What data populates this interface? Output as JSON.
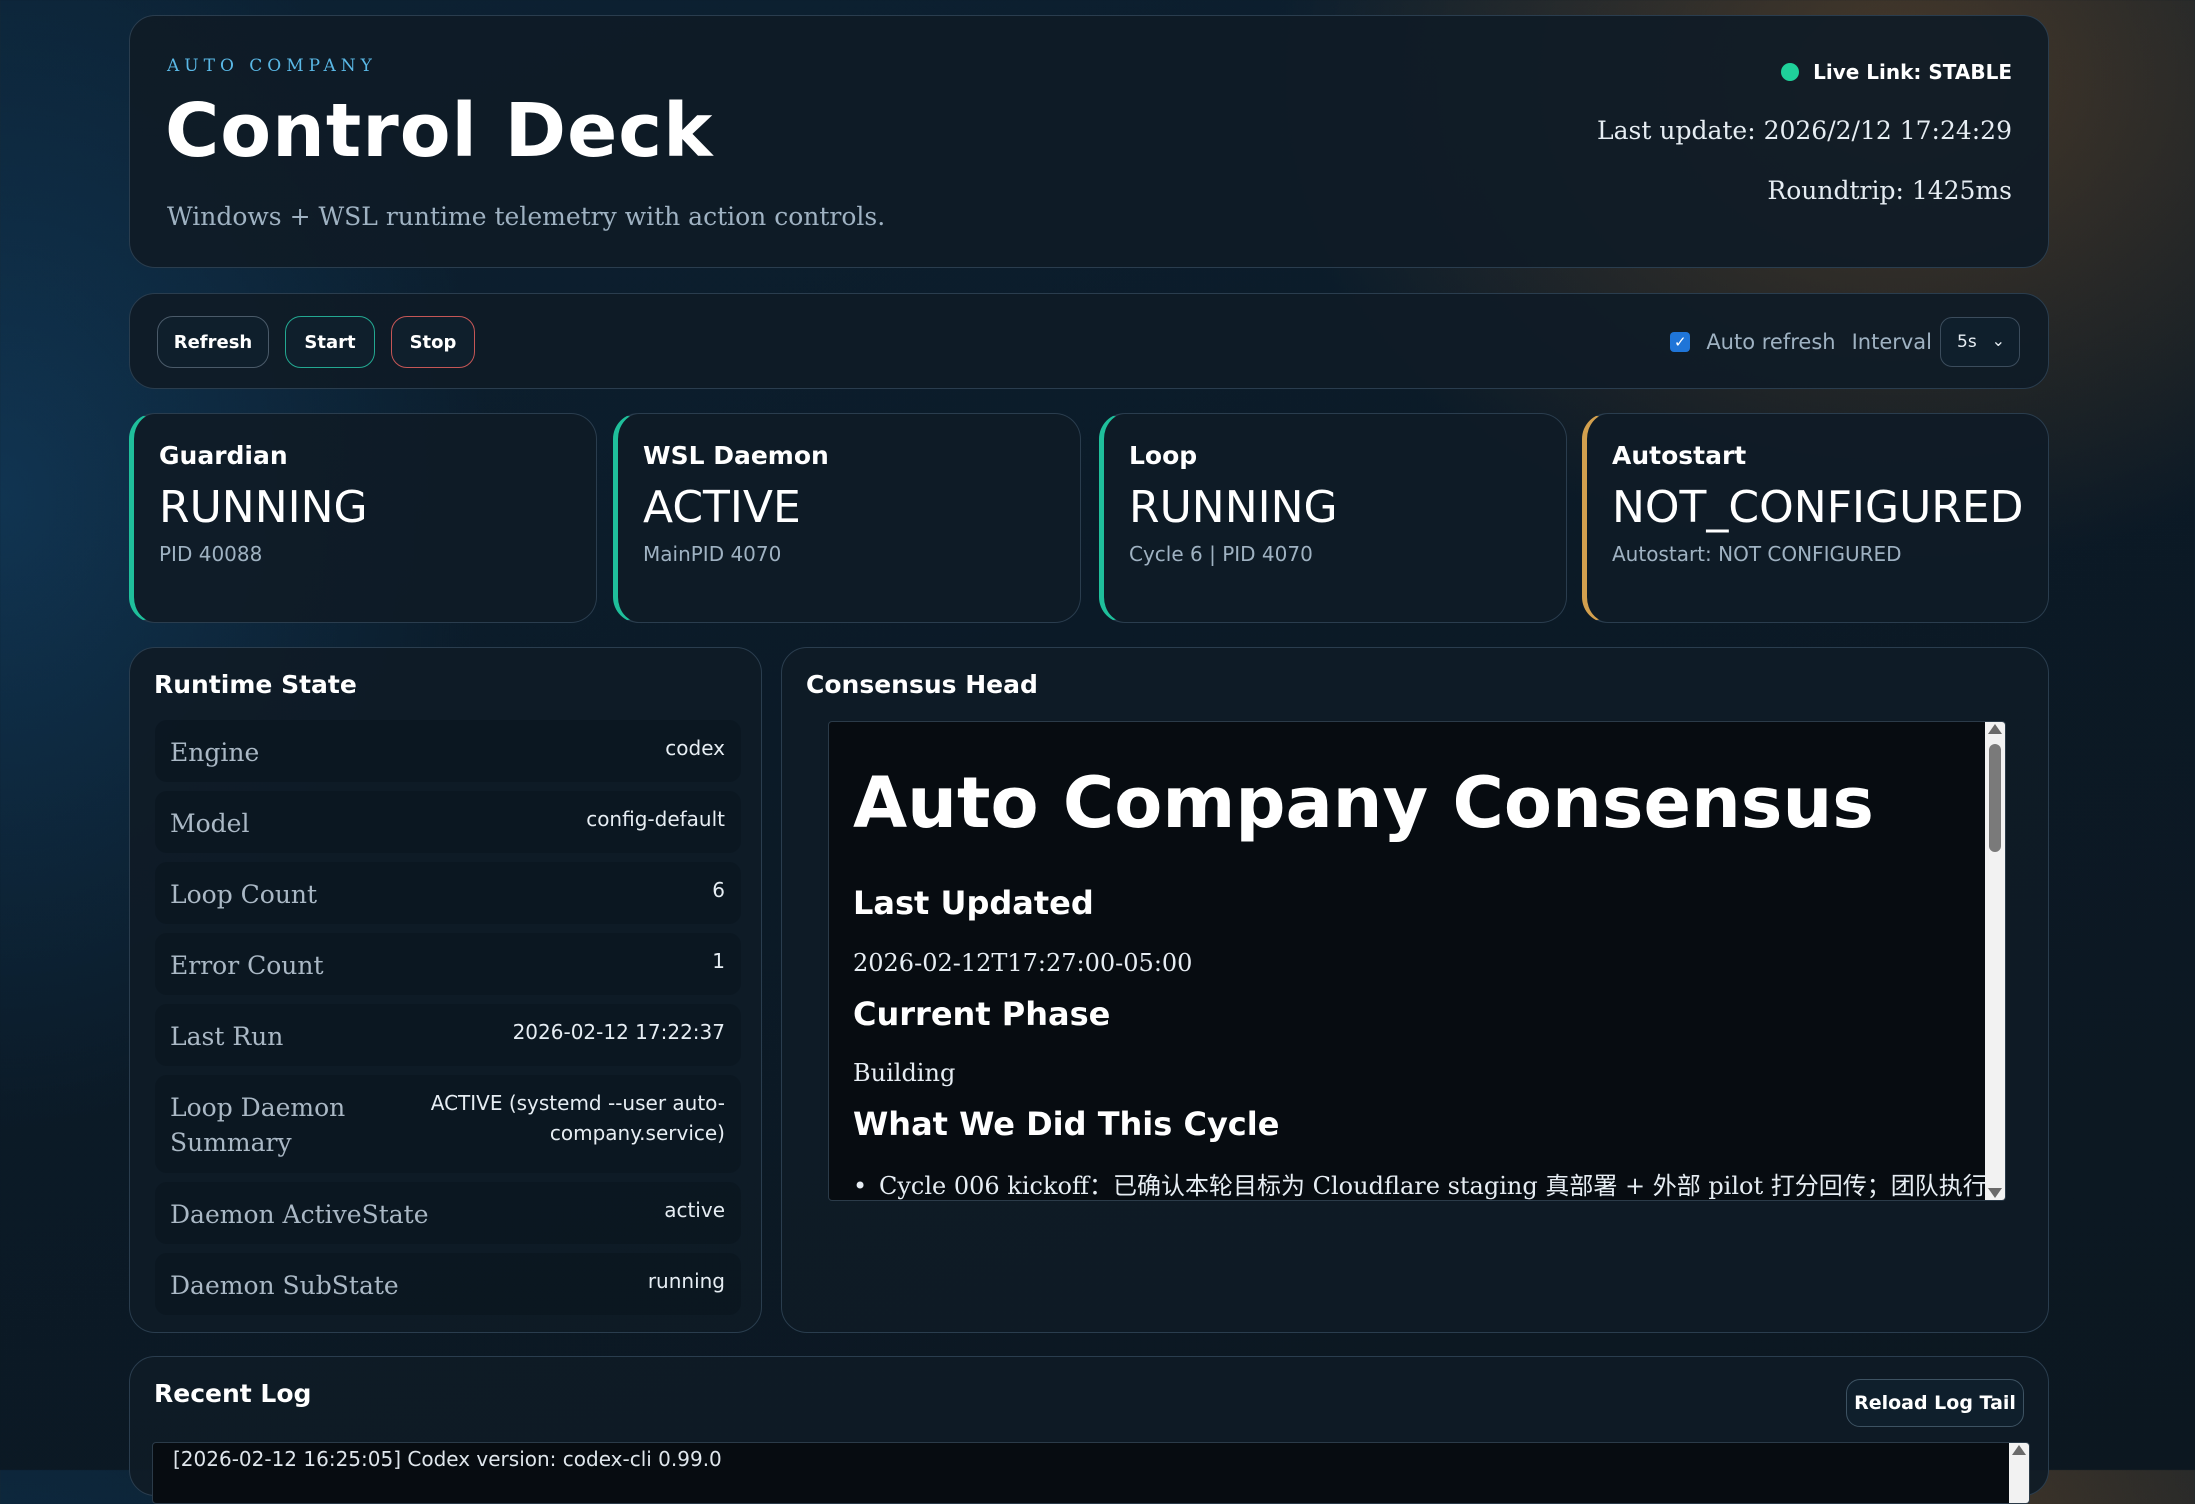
{
  "header": {
    "brand": "AUTO COMPANY",
    "title": "Control Deck",
    "subtitle": "Windows + WSL runtime telemetry with action controls.",
    "live_link": "Live Link: STABLE",
    "last_update": "Last update: 2026/2/12 17:24:29",
    "roundtrip": "Roundtrip: 1425ms"
  },
  "toolbar": {
    "refresh_label": "Refresh",
    "start_label": "Start",
    "stop_label": "Stop",
    "auto_refresh_label": "Auto refresh",
    "auto_refresh_checked": true,
    "interval_label": "Interval",
    "interval_value": "5s"
  },
  "cards": [
    {
      "name": "Guardian",
      "state": "RUNNING",
      "detail": "PID 40088",
      "accent": "#1fbf9b"
    },
    {
      "name": "WSL Daemon",
      "state": "ACTIVE",
      "detail": "MainPID 4070",
      "accent": "#1fbf9b"
    },
    {
      "name": "Loop",
      "state": "RUNNING",
      "detail": "Cycle 6 | PID 4070",
      "accent": "#1fbf9b"
    },
    {
      "name": "Autostart",
      "state": "NOT_CONFIGURED",
      "detail": "Autostart: NOT CONFIGURED",
      "accent": "#d3a04e"
    }
  ],
  "runtime": {
    "title": "Runtime State",
    "rows": [
      {
        "key": "Engine",
        "value": "codex"
      },
      {
        "key": "Model",
        "value": "config-default"
      },
      {
        "key": "Loop Count",
        "value": "6"
      },
      {
        "key": "Error Count",
        "value": "1"
      },
      {
        "key": "Last Run",
        "value": "2026-02-12 17:22:37"
      },
      {
        "key": "Loop Daemon Summary",
        "value": "ACTIVE (systemd --user auto-company.service)"
      },
      {
        "key": "Daemon ActiveState",
        "value": "active"
      },
      {
        "key": "Daemon SubState",
        "value": "running"
      }
    ]
  },
  "consensus": {
    "title": "Consensus Head",
    "heading": "Auto Company Consensus",
    "last_updated_heading": "Last Updated",
    "last_updated_value": "2026-02-12T17:27:00-05:00",
    "phase_heading": "Current Phase",
    "phase_value": "Building",
    "did_heading": "What We Did This Cycle",
    "first_item": "Cycle 006 kickoff：已确认本轮目标为 Cloudflare staging 真部署 + 外部 pilot 打分回传；团队执行"
  },
  "log": {
    "title": "Recent Log",
    "reload_label": "Reload Log Tail",
    "first_line": "[2026-02-12 16:25:05] Codex version: codex-cli 0.99.0"
  },
  "colors": {
    "accent_ok": "#1fbf9b",
    "accent_warn": "#d3a04e",
    "start_border": "#23a891",
    "stop_border": "#c55656",
    "live_dot": "#1fd19a"
  }
}
